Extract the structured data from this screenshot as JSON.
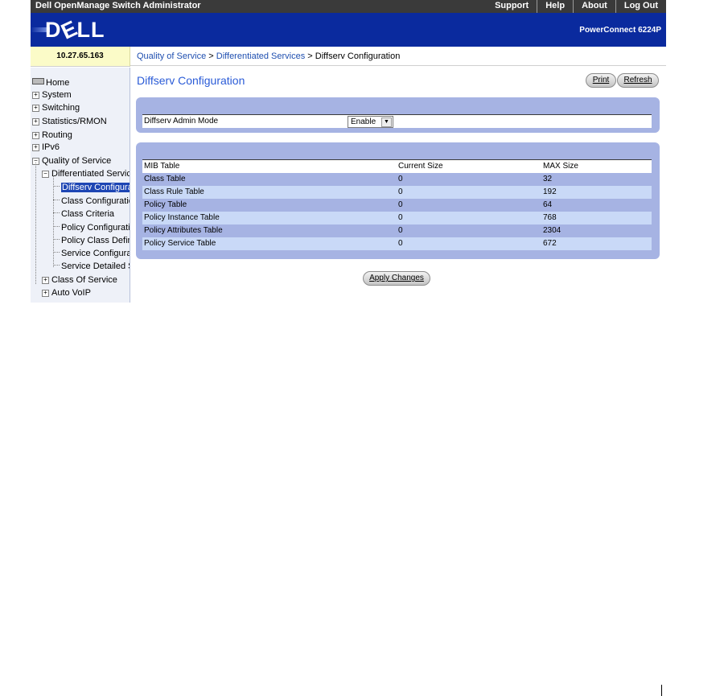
{
  "app": {
    "title": "Dell OpenManage Switch Administrator"
  },
  "topnav": [
    "Support",
    "Help",
    "About",
    "Log Out"
  ],
  "banner": {
    "logo": "DELL",
    "model": "PowerConnect 6224P"
  },
  "ip": "10.27.65.163",
  "breadcrumb": {
    "items": [
      "Quality of Service",
      "Differentiated Services",
      "Diffserv Configuration"
    ],
    "separator": ">"
  },
  "sidebar": {
    "home": "Home",
    "system": "System",
    "switching": "Switching",
    "statistics": "Statistics/RMON",
    "routing": "Routing",
    "ipv6": "IPv6",
    "qos": "Quality of Service",
    "diffserv": "Differentiated Services",
    "sub": [
      "Diffserv Configuration",
      "Class Configuration",
      "Class Criteria",
      "Policy Configuration",
      "Policy Class Definition",
      "Service Configuration",
      "Service Detailed Statistics"
    ],
    "cos": "Class Of Service",
    "autovoip": "Auto VoIP"
  },
  "page": {
    "title": "Diffserv Configuration",
    "print": "Print",
    "refresh": "Refresh",
    "admin_mode_label": "Diffserv Admin Mode",
    "admin_mode_value": "Enable",
    "apply": "Apply Changes"
  },
  "table": {
    "headers": [
      "MIB Table",
      "Current Size",
      "MAX Size"
    ],
    "rows": [
      [
        "Class Table",
        "0",
        "32"
      ],
      [
        "Class Rule Table",
        "0",
        "192"
      ],
      [
        "Policy Table",
        "0",
        "64"
      ],
      [
        "Policy Instance Table",
        "0",
        "768"
      ],
      [
        "Policy Attributes Table",
        "0",
        "2304"
      ],
      [
        "Policy Service Table",
        "0",
        "672"
      ]
    ]
  },
  "colors": {
    "banner": "#0a2a9e",
    "panel": "#a6b3e3",
    "row_alt": "#c9d9f7",
    "title": "#2a5bd7",
    "ip_bg": "#fbfbc8"
  }
}
